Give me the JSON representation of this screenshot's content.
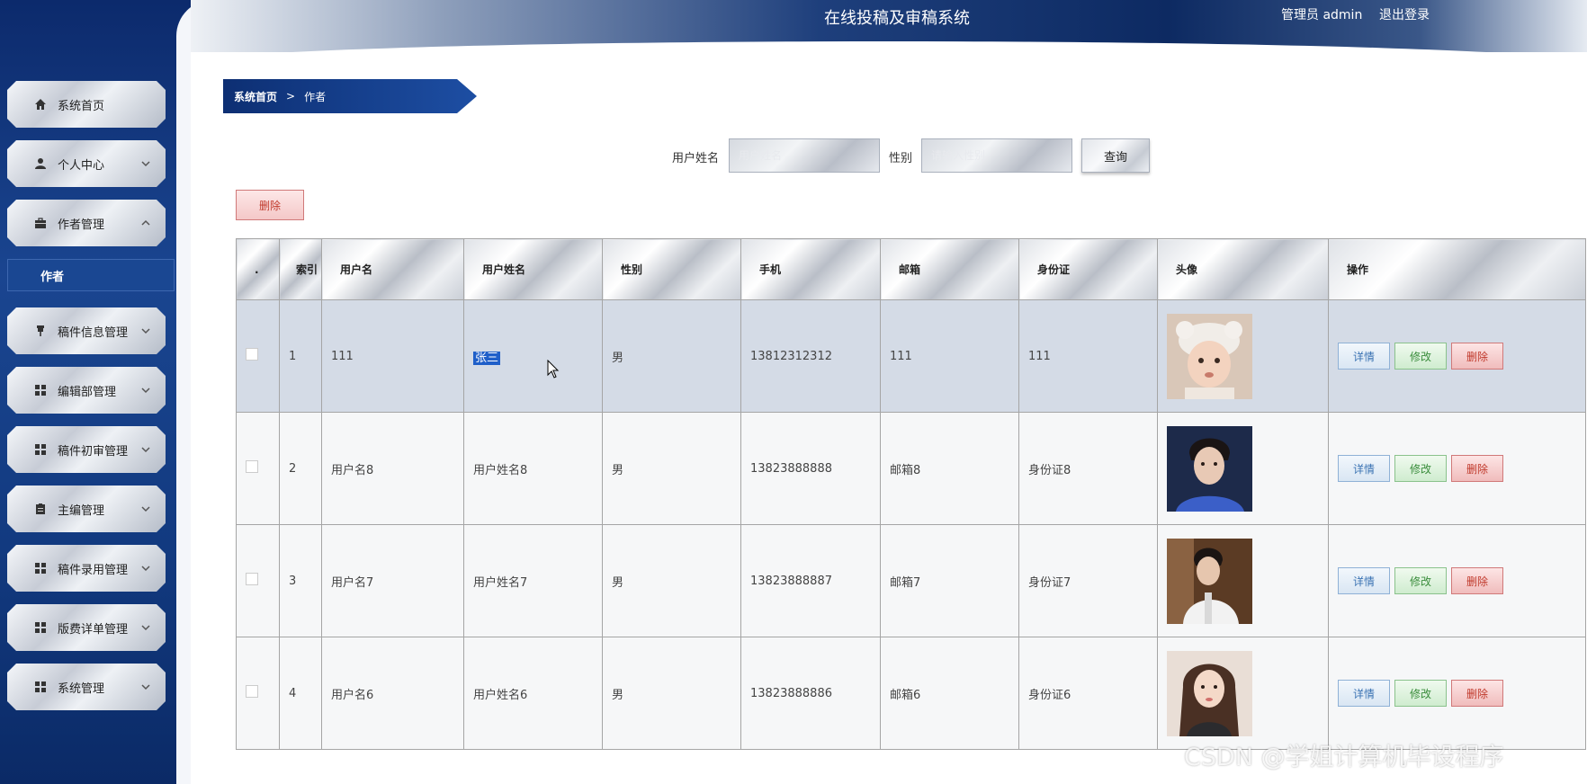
{
  "header": {
    "app_title": "在线投稿及审稿系统",
    "admin_label": "管理员 admin",
    "logout_label": "退出登录"
  },
  "sidebar": {
    "items": [
      {
        "label": "系统首页",
        "icon": "home-icon"
      },
      {
        "label": "个人中心",
        "icon": "user-icon"
      },
      {
        "label": "作者管理",
        "icon": "briefcase-icon",
        "expanded": true
      },
      {
        "label": "稿件信息管理",
        "icon": "pushpin-icon"
      },
      {
        "label": "编辑部管理",
        "icon": "grid-icon"
      },
      {
        "label": "稿件初审管理",
        "icon": "grid-icon"
      },
      {
        "label": "主编管理",
        "icon": "clipboard-icon"
      },
      {
        "label": "稿件录用管理",
        "icon": "grid-icon"
      },
      {
        "label": "版费详单管理",
        "icon": "grid-icon"
      },
      {
        "label": "系统管理",
        "icon": "grid-icon"
      }
    ],
    "subitem_author": "作者"
  },
  "breadcrumb": {
    "home": "系统首页",
    "separator": ">",
    "current": "作者"
  },
  "search": {
    "name_label": "用户姓名",
    "name_placeholder": "用户姓名",
    "gender_label": "性别",
    "gender_placeholder": "请输入性别",
    "query_button": "查询"
  },
  "toolbar": {
    "delete_button": "删除"
  },
  "table": {
    "headers": [
      ".",
      "索引",
      "用户名",
      "用户姓名",
      "性别",
      "手机",
      "邮箱",
      "身份证",
      "头像",
      "操作"
    ],
    "rows": [
      {
        "index": "1",
        "username": "111",
        "realname": "张三",
        "gender": "男",
        "phone": "13812312312",
        "email": "111",
        "idcard": "111",
        "avatar": "toddler-in-white-hat",
        "selected": true
      },
      {
        "index": "2",
        "username": "用户名8",
        "realname": "用户姓名8",
        "gender": "男",
        "phone": "13823888888",
        "email": "邮箱8",
        "idcard": "身份证8",
        "avatar": "man-in-blue-shirt"
      },
      {
        "index": "3",
        "username": "用户名7",
        "realname": "用户姓名7",
        "gender": "男",
        "phone": "13823888887",
        "email": "邮箱7",
        "idcard": "身份证7",
        "avatar": "man-in-white-shirt"
      },
      {
        "index": "4",
        "username": "用户名6",
        "realname": "用户姓名6",
        "gender": "男",
        "phone": "13823888886",
        "email": "邮箱6",
        "idcard": "身份证6",
        "avatar": "woman-portrait"
      }
    ],
    "actions": {
      "detail": "详情",
      "edit": "修改",
      "delete": "删除"
    }
  },
  "watermark": "CSDN @学姐计算机毕设程序",
  "colors": {
    "sidebar_bg": "#123a80",
    "header_dark": "#0d2a62",
    "highlight": "#1f5fc9",
    "delete_red": "#c0392b"
  }
}
